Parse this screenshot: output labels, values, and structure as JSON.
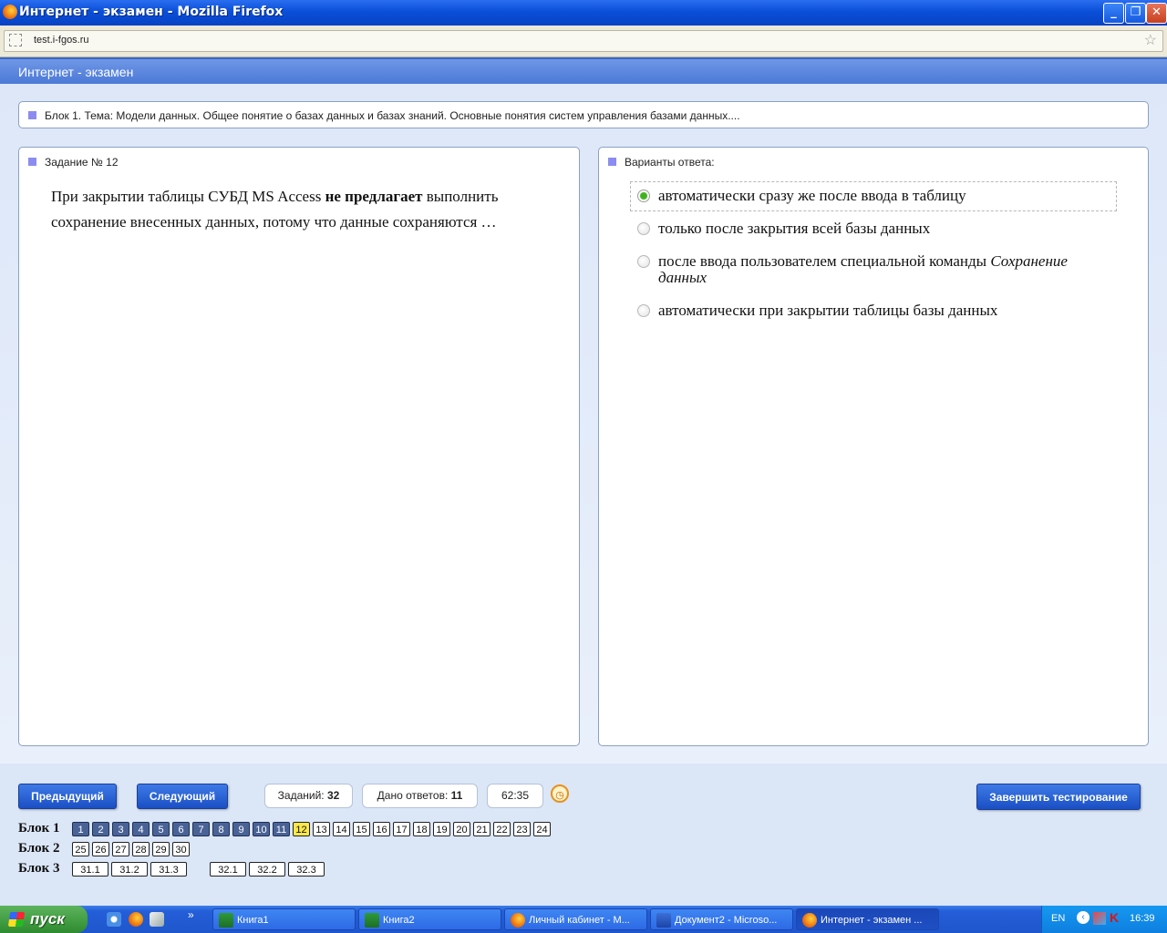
{
  "window": {
    "title": "Интернет - экзамен - Mozilla Firefox",
    "minimize": "_",
    "restore": "❐",
    "close": "✕"
  },
  "address_bar": {
    "url": "test.i-fgos.ru"
  },
  "app_header": {
    "title": "Интернет - экзамен"
  },
  "block_info": {
    "text": "Блок 1. Тема: Модели данных. Общее понятие о базах данных и базах знаний. Основные понятия систем управления базами данных...."
  },
  "task": {
    "heading": "Задание № 12",
    "question_pre": "При закрытии таблицы СУБД MS Access ",
    "question_bold": "не предлагает",
    "question_post": " выполнить сохранение внесенных данных, потому что данные сохраняются …"
  },
  "answers": {
    "heading": "Варианты ответа:",
    "options": [
      {
        "text": "автоматически сразу же после ввода в таблицу",
        "selected": true
      },
      {
        "text": "только после закрытия всей базы данных",
        "selected": false
      },
      {
        "text": "после ввода пользователем специальной команды ",
        "italic": "Сохранение данных",
        "selected": false
      },
      {
        "text": "автоматически при закрытии таблицы базы данных",
        "selected": false
      }
    ]
  },
  "footer": {
    "prev_label": "Предыдущий",
    "next_label": "Следующий",
    "tasks_label": "Заданий:",
    "tasks_count": "32",
    "answered_label": "Дано ответов:",
    "answered_count": "11",
    "timer": "62:35",
    "finish_label": "Завершить тестирование",
    "blocks": [
      {
        "label": "Блок 1",
        "items": [
          "1",
          "2",
          "3",
          "4",
          "5",
          "6",
          "7",
          "8",
          "9",
          "10",
          "11",
          "12",
          "13",
          "14",
          "15",
          "16",
          "17",
          "18",
          "19",
          "20",
          "21",
          "22",
          "23",
          "24"
        ],
        "answered_through": 11,
        "current": "12"
      },
      {
        "label": "Блок 2",
        "items": [
          "25",
          "26",
          "27",
          "28",
          "29",
          "30"
        ]
      },
      {
        "label": "Блок 3",
        "items": [
          "31.1",
          "31.2",
          "31.3",
          "32.1",
          "32.2",
          "32.3"
        ]
      }
    ]
  },
  "taskbar": {
    "start_label": "пуск",
    "chevron": "»",
    "buttons": [
      {
        "label": "Книга1",
        "icon": "excel-icon"
      },
      {
        "label": "Книга2",
        "icon": "excel-icon"
      },
      {
        "label": "Личный кабинет - М...",
        "icon": "firefox-icon"
      },
      {
        "label": "Документ2 - Microso...",
        "icon": "word-icon"
      },
      {
        "label": "Интернет - экзамен ...",
        "icon": "firefox-icon",
        "active": true
      }
    ],
    "language": "EN",
    "clock": "16:39"
  }
}
